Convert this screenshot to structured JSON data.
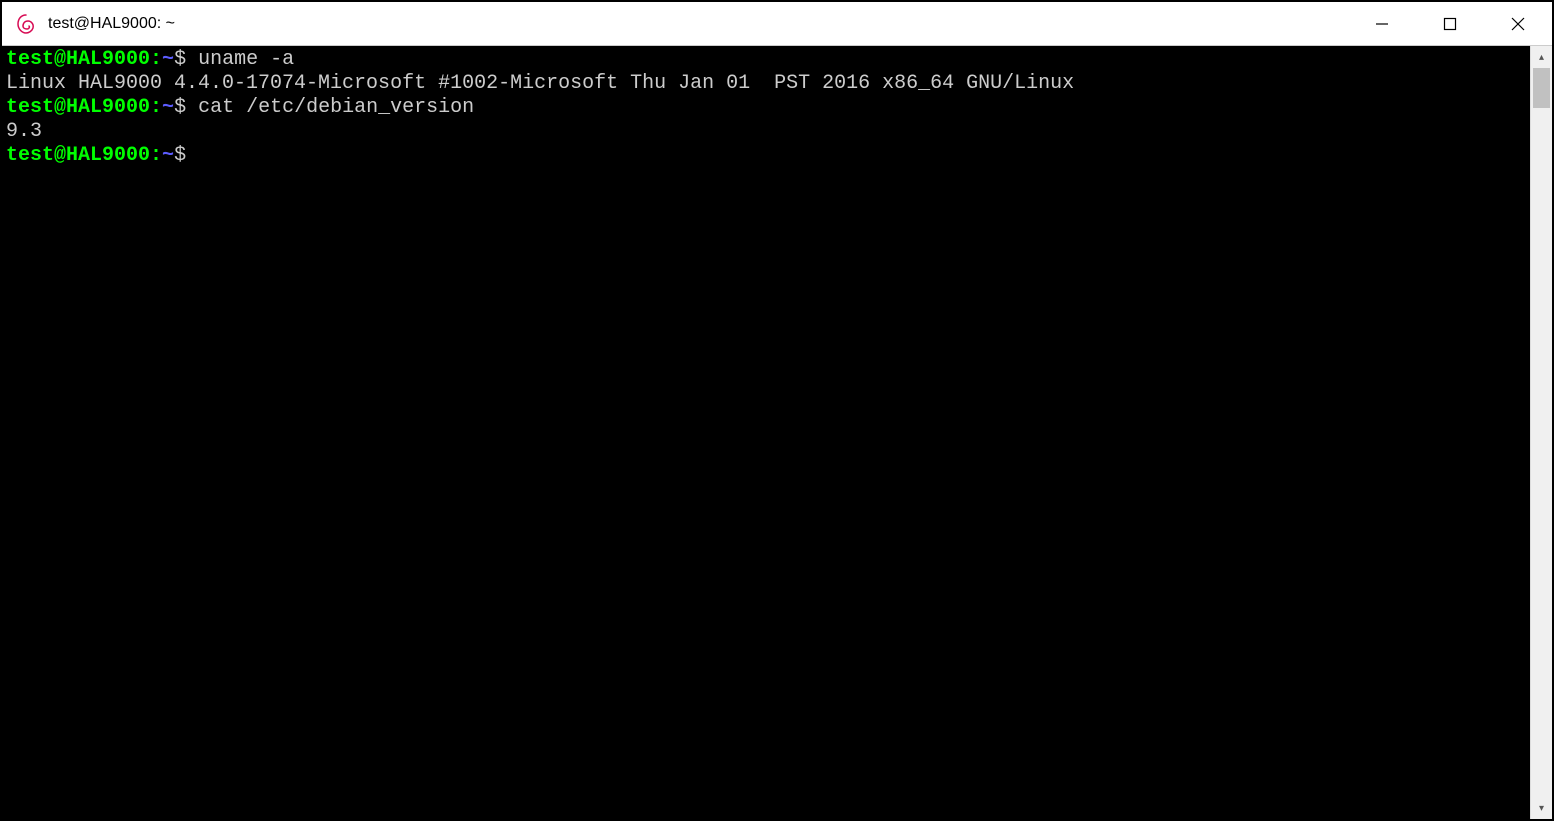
{
  "window": {
    "title": "test@HAL9000: ~"
  },
  "terminal": {
    "lines": [
      {
        "prompt_user": "test@HAL9000",
        "prompt_sep": ":",
        "prompt_path": "~",
        "prompt_end": "$ ",
        "command": "uname -a"
      },
      {
        "output": "Linux HAL9000 4.4.0-17074-Microsoft #1002-Microsoft Thu Jan 01  PST 2016 x86_64 GNU/Linux"
      },
      {
        "prompt_user": "test@HAL9000",
        "prompt_sep": ":",
        "prompt_path": "~",
        "prompt_end": "$ ",
        "command": "cat /etc/debian_version"
      },
      {
        "output": "9.3"
      },
      {
        "prompt_user": "test@HAL9000",
        "prompt_sep": ":",
        "prompt_path": "~",
        "prompt_end": "$ ",
        "command": ""
      }
    ]
  },
  "icons": {
    "debian": "debian-swirl-icon",
    "minimize": "minimize-icon",
    "maximize": "maximize-icon",
    "close": "close-icon",
    "scroll_up": "chevron-up-icon",
    "scroll_down": "chevron-down-icon"
  }
}
